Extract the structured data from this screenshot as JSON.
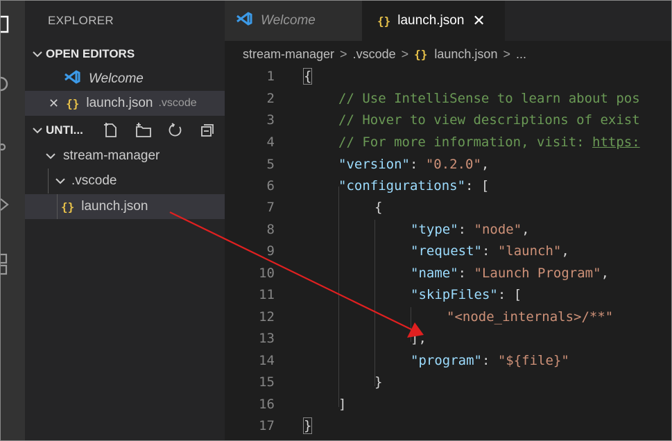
{
  "sidebar": {
    "title": "EXPLORER",
    "open_editors": {
      "header": "OPEN EDITORS",
      "items": [
        {
          "label": "Welcome",
          "desc": ""
        },
        {
          "label": "launch.json",
          "desc": ".vscode",
          "glyph": "{}"
        }
      ],
      "close_glyph": "✕"
    },
    "workspace": {
      "header": "UNTI...",
      "tree": [
        {
          "label": "stream-manager"
        },
        {
          "label": ".vscode"
        },
        {
          "label": "launch.json",
          "glyph": "{}"
        }
      ]
    }
  },
  "tabs": [
    {
      "label": "Welcome"
    },
    {
      "label": "launch.json",
      "glyph": "{}",
      "close": "✕"
    }
  ],
  "breadcrumb": {
    "items": [
      "stream-manager",
      ".vscode",
      "launch.json",
      "..."
    ],
    "separator": ">",
    "glyph": "{}"
  },
  "editor": {
    "line_numbers": [
      "1",
      "2",
      "3",
      "4",
      "5",
      "6",
      "7",
      "8",
      "9",
      "10",
      "11",
      "12",
      "13",
      "14",
      "15",
      "16",
      "17"
    ],
    "lines": {
      "l1": "{",
      "l2": "// Use IntelliSense to learn about pos",
      "l3": "// Hover to view descriptions of exist",
      "l4a": "// For more information, visit: ",
      "l4b": "https:",
      "l5k": "\"version\"",
      "l5c": ": ",
      "l5v": "\"0.2.0\"",
      "l5e": ",",
      "l6k": "\"configurations\"",
      "l6e": ": [",
      "l7": "{",
      "l8k": "\"type\"",
      "l8c": ": ",
      "l8v": "\"node\"",
      "l8e": ",",
      "l9k": "\"request\"",
      "l9c": ": ",
      "l9v": "\"launch\"",
      "l9e": ",",
      "l10k": "\"name\"",
      "l10c": ": ",
      "l10v": "\"Launch Program\"",
      "l10e": ",",
      "l11k": "\"skipFiles\"",
      "l11e": ": [",
      "l12v": "\"<node_internals>/**\"",
      "l13": "],",
      "l14k": "\"program\"",
      "l14c": ": ",
      "l14v": "\"${file}\"",
      "l15": "}",
      "l16": "]",
      "l17": "}"
    }
  },
  "colors": {
    "arrow": "#e02020",
    "vscode_blue": "#3c9ae8",
    "json_glyph": "#e8c24a"
  }
}
